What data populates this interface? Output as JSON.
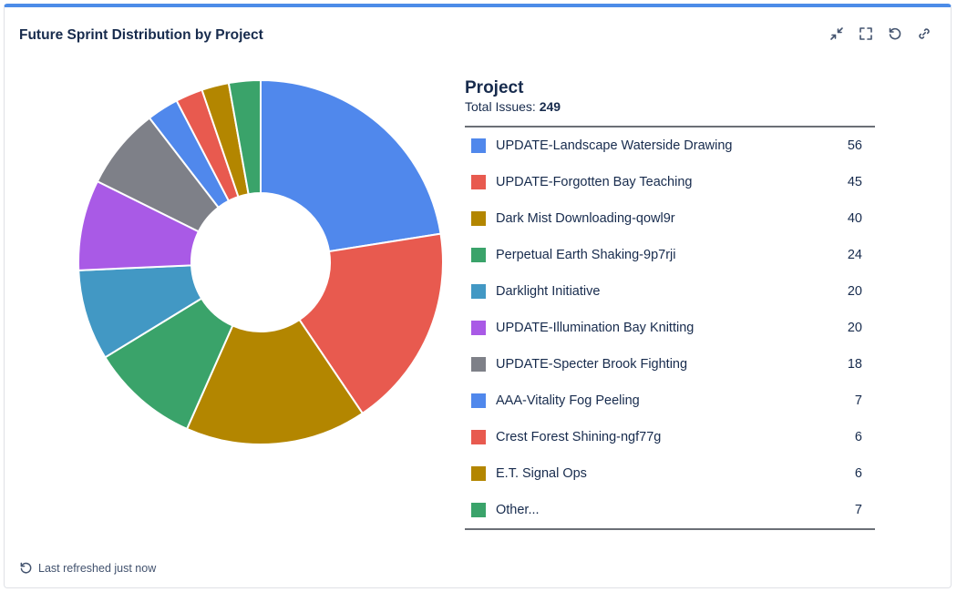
{
  "header": {
    "title": "Future Sprint Distribution by Project"
  },
  "toolbar": {
    "icons": [
      "collapse-icon",
      "fullscreen-icon",
      "refresh-icon",
      "link-icon"
    ]
  },
  "legend": {
    "title": "Project",
    "total_label": "Total Issues:",
    "total_value": "249"
  },
  "footer": {
    "refresh_text": "Last refreshed just now"
  },
  "chart_data": {
    "type": "pie",
    "donut": true,
    "total": 249,
    "categories": [
      "UPDATE-Landscape Waterside Drawing",
      "UPDATE-Forgotten Bay Teaching",
      "Dark Mist Downloading-qowl9r",
      "Perpetual Earth Shaking-9p7rji",
      "Darklight Initiative",
      "UPDATE-Illumination Bay Knitting",
      "UPDATE-Specter Brook Fighting",
      "AAA-Vitality Fog Peeling",
      "Crest Forest Shining-ngf77g",
      "E.T. Signal Ops",
      "Other..."
    ],
    "values": [
      56,
      45,
      40,
      24,
      20,
      20,
      18,
      7,
      6,
      6,
      7
    ],
    "colors": [
      "#5088ec",
      "#e85a4f",
      "#b38600",
      "#3aa36a",
      "#4298c4",
      "#a95ae6",
      "#7e8088",
      "#5088ec",
      "#e85a4f",
      "#b38600",
      "#3aa36a"
    ],
    "legend_position": "right"
  }
}
